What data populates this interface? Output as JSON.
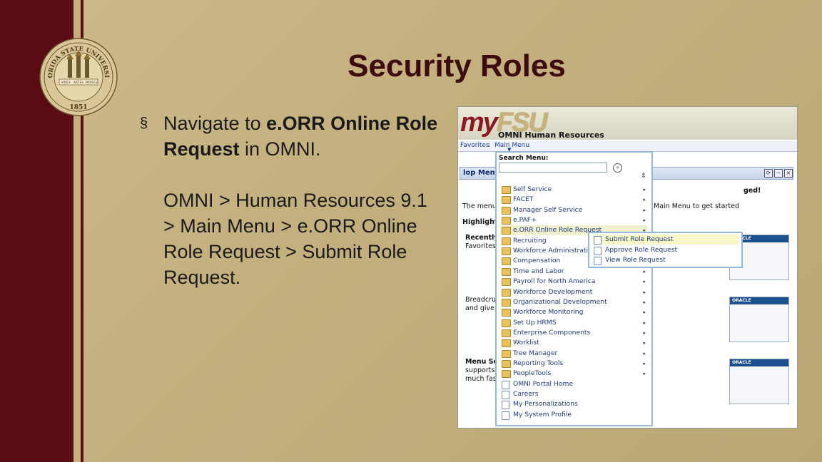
{
  "slide": {
    "title": "Security Roles",
    "bullet_mark": "§",
    "bullet_plain_1": "Navigate to ",
    "bullet_bold": "e.ORR Online Role Request",
    "bullet_plain_2": " in OMNI.",
    "path": "OMNI > Human Resources 9.1 > Main Menu > e.ORR Online Role Request > Submit Role Request.",
    "seal": {
      "top_text": "FLORIDA STATE UNIVERSITY",
      "year": "1851",
      "banner_left": "VIRES",
      "banner_mid": "ARTES",
      "banner_right": "MORES"
    }
  },
  "app": {
    "logo_my": "my",
    "logo_fsu": "FSU",
    "subtitle": "OMNI Human Resources",
    "nav": {
      "favorites": "Favorites",
      "main_menu": "Main Menu"
    },
    "pagelet_title": "lop Menu",
    "search_menu_label": "Search Menu:",
    "background": {
      "greeting_end": "ged!",
      "the_menu": "The menu",
      "get_started": "Main Menu to get started",
      "highlights": "Highlights",
      "recently": "Recently",
      "favorites": "Favorites",
      "breadcrumbs": "Breadcru",
      "and_give": "and give y",
      "menu_se": "Menu Se",
      "supports": "supports",
      "much_fast": "much fas",
      "oracle": "ORACLE"
    },
    "menu_items": [
      {
        "label": "Self Service",
        "type": "folder",
        "arrow": true
      },
      {
        "label": "FACET",
        "type": "folder",
        "arrow": true
      },
      {
        "label": "Manager Self Service",
        "type": "folder",
        "arrow": true
      },
      {
        "label": "e.PAF+",
        "type": "folder",
        "arrow": true
      },
      {
        "label": "e.ORR Online Role Request",
        "type": "folder",
        "arrow": true,
        "highlight": true
      },
      {
        "label": "Recruiting",
        "type": "folder",
        "arrow": true
      },
      {
        "label": "Workforce Administration",
        "type": "folder",
        "arrow": true
      },
      {
        "label": "Compensation",
        "type": "folder",
        "arrow": true
      },
      {
        "label": "Time and Labor",
        "type": "folder",
        "arrow": true
      },
      {
        "label": "Payroll for North America",
        "type": "folder",
        "arrow": true
      },
      {
        "label": "Workforce Development",
        "type": "folder",
        "arrow": true
      },
      {
        "label": "Organizational Development",
        "type": "folder",
        "arrow": true
      },
      {
        "label": "Workforce Monitoring",
        "type": "folder",
        "arrow": true
      },
      {
        "label": "Set Up HRMS",
        "type": "folder",
        "arrow": true
      },
      {
        "label": "Enterprise Components",
        "type": "folder",
        "arrow": true
      },
      {
        "label": "Worklist",
        "type": "folder",
        "arrow": true
      },
      {
        "label": "Tree Manager",
        "type": "folder",
        "arrow": true
      },
      {
        "label": "Reporting Tools",
        "type": "folder",
        "arrow": true
      },
      {
        "label": "PeopleTools",
        "type": "folder",
        "arrow": true
      },
      {
        "label": "OMNI Portal Home",
        "type": "doc",
        "arrow": false
      },
      {
        "label": "Careers",
        "type": "doc",
        "arrow": false
      },
      {
        "label": "My Personalizations",
        "type": "doc",
        "arrow": false
      },
      {
        "label": "My System Profile",
        "type": "doc",
        "arrow": false
      }
    ],
    "submenu_items": [
      {
        "label": "Submit Role Request",
        "highlight": true
      },
      {
        "label": "Approve Role Request",
        "highlight": false
      },
      {
        "label": "View Role Request",
        "highlight": false
      }
    ]
  },
  "colors": {
    "garnet": "#5a0b14",
    "gold": "#c4b07e",
    "title": "#3d0a0e",
    "link": "#1e3a7a"
  }
}
